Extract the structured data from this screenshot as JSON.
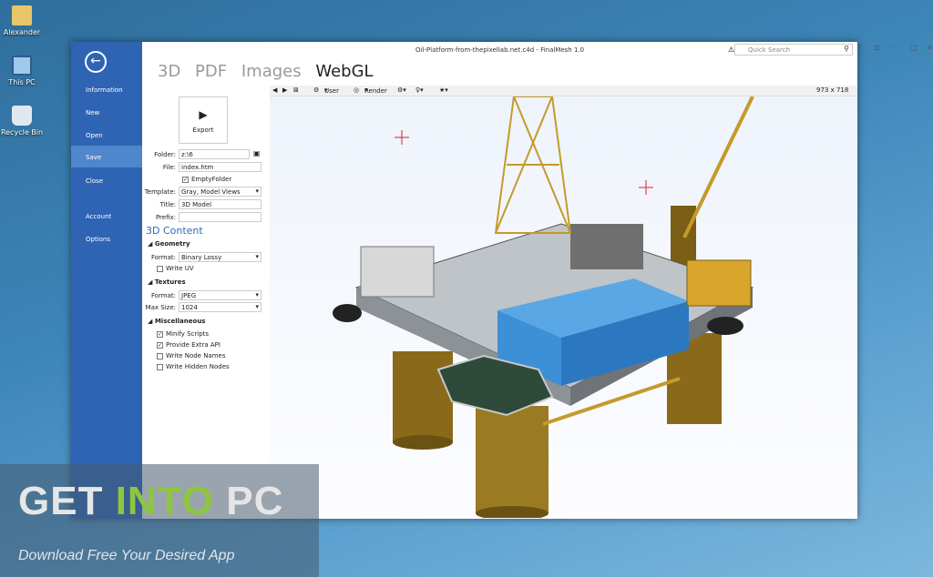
{
  "desktop": {
    "icons": [
      {
        "label": "Alexander"
      },
      {
        "label": "This PC"
      },
      {
        "label": "Recycle Bin"
      }
    ]
  },
  "window": {
    "title": "Oil-Platform-from-thepixellab.net.c4d - FinalMesh 1.0",
    "quick_search_placeholder": "Quick Search"
  },
  "backstage": {
    "items": [
      {
        "label": "Information"
      },
      {
        "label": "New"
      },
      {
        "label": "Open"
      },
      {
        "label": "Save"
      },
      {
        "label": "Close"
      },
      {
        "label": "Account"
      },
      {
        "label": "Options"
      }
    ],
    "active": "Save"
  },
  "tabs": [
    "3D",
    "PDF",
    "Images",
    "WebGL"
  ],
  "panel": {
    "export_label": "Export",
    "folder_label": "Folder:",
    "folder_value": "z:\\6",
    "file_label": "File:",
    "file_value": "index.htm",
    "empty_folder": "EmptyFolder",
    "template_label": "Template:",
    "template_value": "Gray, Model Views",
    "title_label": "Title:",
    "title_value": "3D Model",
    "prefix_label": "Prefix:",
    "prefix_value": "",
    "section_3d": "3D Content",
    "geometry": "Geometry",
    "geo_format_label": "Format:",
    "geo_format_value": "Binary Lossy",
    "write_uv": "Write UV",
    "textures": "Textures",
    "tex_format_label": "Format:",
    "tex_format_value": "JPEG",
    "max_size_label": "Max Size:",
    "max_size_value": "1024",
    "misc": "Miscellaneous",
    "minify": "Minify Scripts",
    "extra_api": "Provide Extra API",
    "node_names": "Write Node Names",
    "hidden_nodes": "Write Hidden Nodes"
  },
  "toolbar": {
    "user": "User",
    "render": "Render",
    "size": "973 x 718"
  },
  "watermark": {
    "get": "GET ",
    "into": "INTO",
    "pc": " PC",
    "tagline": "Download Free Your Desired App"
  }
}
